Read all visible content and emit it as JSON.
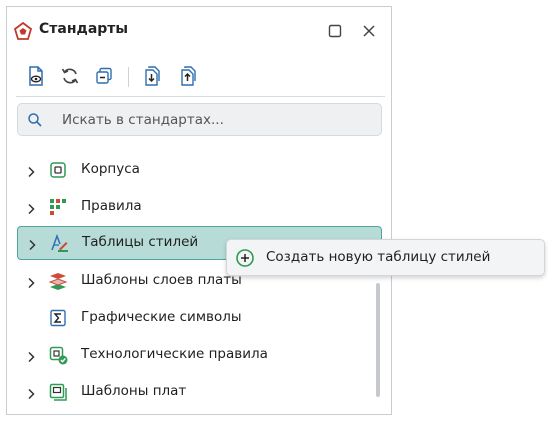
{
  "panel": {
    "title": "Стандарты",
    "icon": "standards-pentagon-icon",
    "window_buttons": [
      "maximize-icon",
      "close-icon"
    ]
  },
  "toolbar": {
    "buttons": [
      "document-view-icon",
      "refresh-icon",
      "collapse-all-icon",
      "import-icon",
      "export-icon"
    ]
  },
  "search": {
    "placeholder": "Искать в стандартах..."
  },
  "tree": {
    "items": [
      {
        "label": "Корпуса",
        "expandable": true,
        "icon": "package-chip-icon"
      },
      {
        "label": "Правила",
        "expandable": true,
        "icon": "rules-grid-icon"
      },
      {
        "label": "Таблицы стилей",
        "expandable": true,
        "icon": "style-table-icon",
        "selected": true
      },
      {
        "label": "Шаблоны слоев платы",
        "expandable": true,
        "icon": "layer-stack-icon"
      },
      {
        "label": "Графические символы",
        "expandable": false,
        "icon": "sigma-symbol-icon"
      },
      {
        "label": "Технологические правила",
        "expandable": true,
        "icon": "chip-check-icon"
      },
      {
        "label": "Шаблоны плат",
        "expandable": true,
        "icon": "board-template-icon"
      }
    ]
  },
  "context_menu": {
    "items": [
      {
        "label": "Создать новую таблицу стилей",
        "icon": "plus-circle-icon"
      }
    ]
  },
  "colors": {
    "accent": "#2e9a53",
    "selection_bg": "#b7dcd8",
    "selection_border": "#4fa59e",
    "brand_red": "#c0392b"
  }
}
